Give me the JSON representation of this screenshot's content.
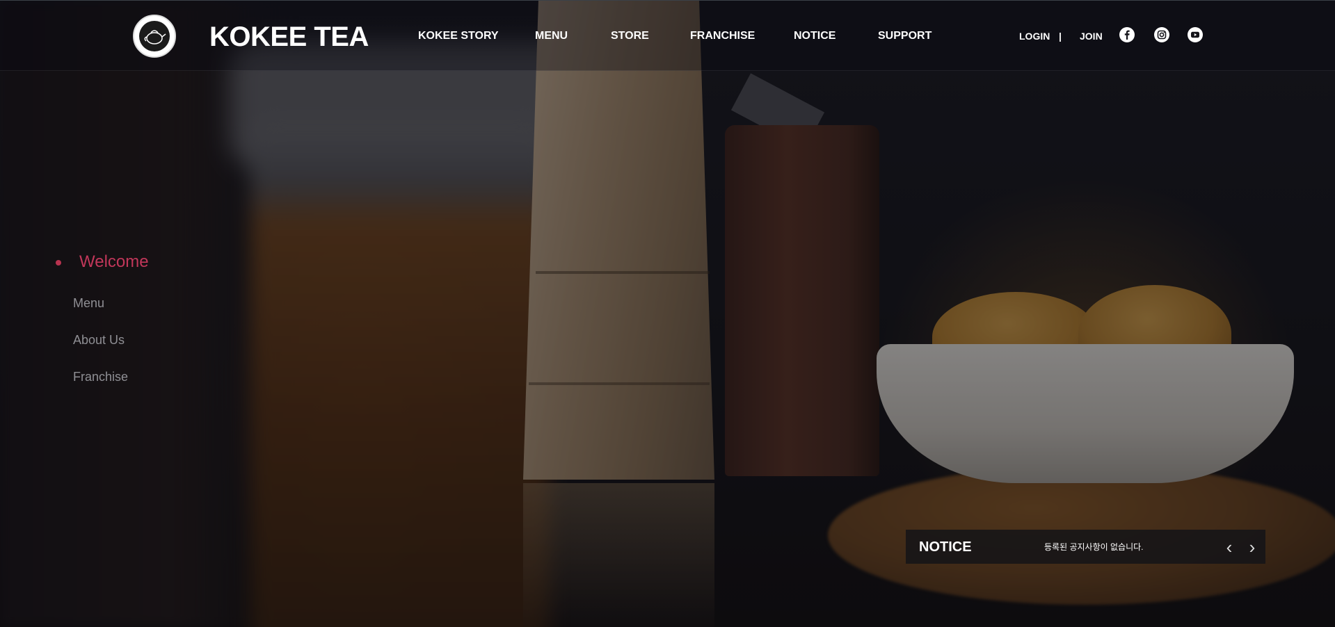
{
  "header": {
    "brand": "KOKEE TEA",
    "nav": [
      {
        "label": "KOKEE STORY"
      },
      {
        "label": "MENU"
      },
      {
        "label": "STORE"
      },
      {
        "label": "FRANCHISE"
      },
      {
        "label": "NOTICE"
      },
      {
        "label": "SUPPORT"
      }
    ],
    "login": "LOGIN",
    "separator": "|",
    "join": "JOIN",
    "social": [
      "facebook-icon",
      "instagram-icon",
      "youtube-icon"
    ]
  },
  "side_menu": {
    "active": "Welcome",
    "items": [
      "Menu",
      "About Us",
      "Franchise"
    ]
  },
  "notice_bar": {
    "title": "NOTICE",
    "message": "등록된 공지사항이 없습니다.",
    "prev": "‹",
    "next": "›"
  },
  "colors": {
    "accent": "#c2375a",
    "side_text": "#8f8f94"
  }
}
